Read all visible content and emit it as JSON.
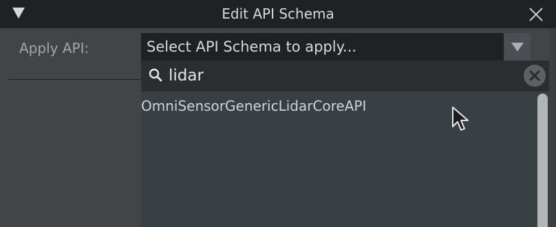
{
  "dialog": {
    "title": "Edit API Schema",
    "collapse_icon": "triangle-down-icon",
    "close_icon": "close-x-icon"
  },
  "apply_api": {
    "label": "Apply API:",
    "combo_placeholder": "Select API Schema to apply...",
    "combo_arrow_icon": "chevron-down-icon"
  },
  "search": {
    "icon": "search-icon",
    "value": "lidar",
    "clear_icon": "clear-icon"
  },
  "results": [
    {
      "label": "OmniSensorGenericLidarCoreAPI"
    }
  ],
  "colors": {
    "panel": "#424548",
    "titlebar": "#1f2224",
    "dropdown": "#394044",
    "search_bar": "#2a2e31",
    "text": "#d7d9db",
    "label": "#a2a6aa"
  }
}
